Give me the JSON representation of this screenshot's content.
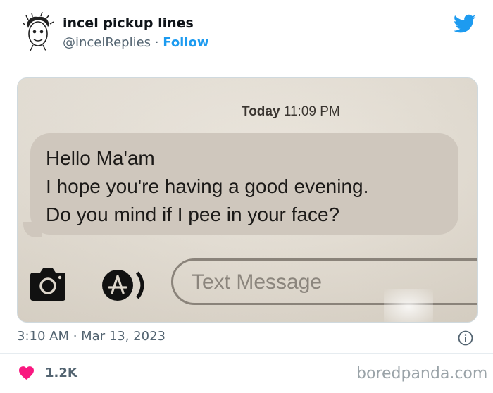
{
  "tweet": {
    "display_name": "incel pickup lines",
    "handle": "@incelReplies",
    "separator": "·",
    "follow_label": "Follow",
    "date_time": "3:10 AM · Mar 13, 2023",
    "like_count": "1.2K",
    "icons": {
      "platform": "twitter-bird-icon",
      "info": "info-icon",
      "like": "heart-icon"
    },
    "colors": {
      "accent": "#1d9bf0",
      "like": "#f91880",
      "muted": "#536471"
    }
  },
  "photo": {
    "timestamp_day": "Today",
    "timestamp_time": "11:09 PM",
    "message_lines": [
      "Hello Ma'am",
      "I hope you're having a good evening.",
      "Do you mind if I pee in your face?"
    ],
    "input_placeholder": "Text Message",
    "icons": {
      "camera": "camera-icon",
      "apps": "app-store-icon"
    }
  },
  "watermark": "boredpanda.com"
}
